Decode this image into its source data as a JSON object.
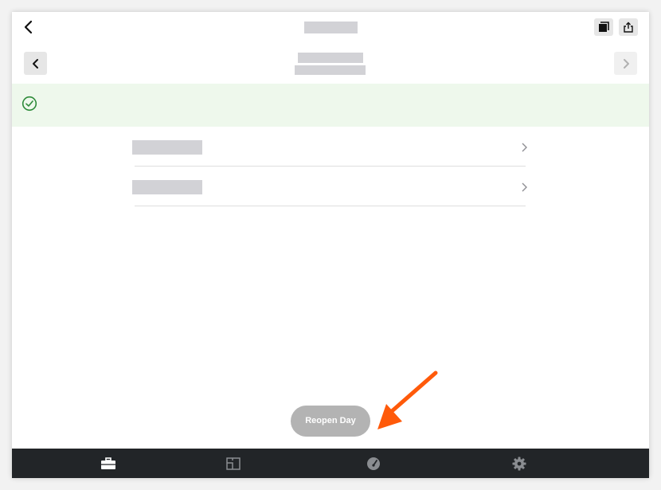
{
  "header": {
    "back_icon": "chevron-left-icon",
    "copy_icon": "copy-icon",
    "share_icon": "share-icon"
  },
  "date_nav": {
    "prev_icon": "chevron-left-icon",
    "next_icon": "chevron-right-icon"
  },
  "banner": {
    "icon": "check-circle-icon",
    "color": "#2e8b3a",
    "background": "#eef8ec"
  },
  "list": {
    "rows": [
      {
        "icon": "chevron-right-icon"
      },
      {
        "icon": "chevron-right-icon"
      }
    ]
  },
  "actions": {
    "reopen_label": "Reopen Day",
    "annotation_color": "#ff5a0a"
  },
  "tabbar": {
    "items": [
      {
        "icon": "briefcase-icon",
        "active": true
      },
      {
        "icon": "floorplan-icon",
        "active": false
      },
      {
        "icon": "dashboard-icon",
        "active": false
      },
      {
        "icon": "gear-icon",
        "active": false
      }
    ]
  }
}
